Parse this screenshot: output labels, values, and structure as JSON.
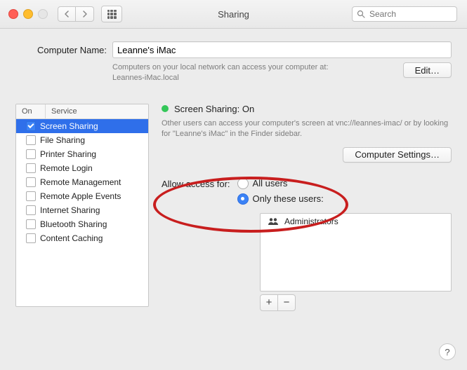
{
  "window": {
    "title": "Sharing",
    "search_placeholder": "Search"
  },
  "computer_name": {
    "label": "Computer Name:",
    "value": "Leanne's iMac",
    "hint_line1": "Computers on your local network can access your computer at:",
    "hint_line2": "Leannes-iMac.local",
    "edit_button": "Edit…"
  },
  "services": {
    "header_on": "On",
    "header_service": "Service",
    "items": [
      {
        "on": true,
        "label": "Screen Sharing",
        "selected": true
      },
      {
        "on": false,
        "label": "File Sharing",
        "selected": false
      },
      {
        "on": false,
        "label": "Printer Sharing",
        "selected": false
      },
      {
        "on": false,
        "label": "Remote Login",
        "selected": false
      },
      {
        "on": false,
        "label": "Remote Management",
        "selected": false
      },
      {
        "on": false,
        "label": "Remote Apple Events",
        "selected": false
      },
      {
        "on": false,
        "label": "Internet Sharing",
        "selected": false
      },
      {
        "on": false,
        "label": "Bluetooth Sharing",
        "selected": false
      },
      {
        "on": false,
        "label": "Content Caching",
        "selected": false
      }
    ]
  },
  "detail": {
    "status_color": "#34c759",
    "status_text": "Screen Sharing: On",
    "description": "Other users can access your computer's screen at vnc://leannes-imac/ or by looking for \"Leanne's iMac\" in the Finder sidebar.",
    "computer_settings_button": "Computer Settings…",
    "access_label": "Allow access for:",
    "radio_all": "All users",
    "radio_only": "Only these users:",
    "radio_selected": "only",
    "users": [
      {
        "name": "Administrators"
      }
    ],
    "add": "+",
    "remove": "−"
  },
  "help": "?"
}
